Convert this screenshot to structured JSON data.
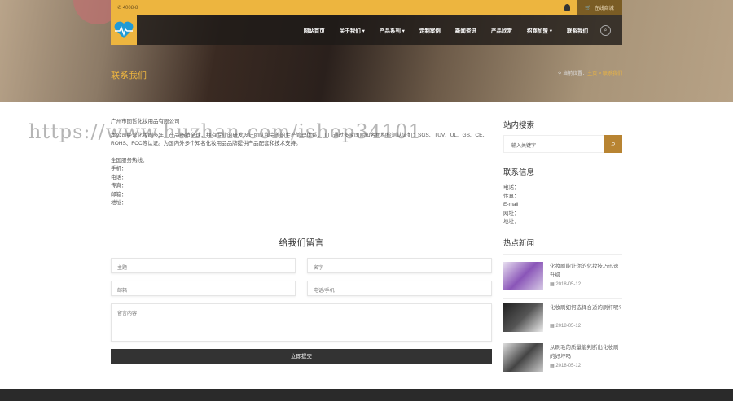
{
  "topbar": {
    "phone": "4008-8",
    "shop_label": "在线商城"
  },
  "nav": {
    "items": [
      "网站首页",
      "关于我们 ▾",
      "产品系列 ▾",
      "定制案例",
      "新闻资讯",
      "产品欣赏",
      "招商加盟 ▾",
      "联系我们"
    ]
  },
  "banner": {
    "title": "联系我们",
    "crumb_prefix": "当前位置：",
    "crumb_home": "主页",
    "crumb_sep": " > ",
    "crumb_current": "联系我们"
  },
  "main": {
    "company": "广州市图哲化妆用品有限公司",
    "para": "本公司经营化妆刷多年，产品畅销全球，拥有专业的研发设计团队和完善的生产管理体系，工厂通过多家国际知名机构检测认证如：SGS、TUV、UL、GS、CE、ROHS、FCC等认证。为国内外多个知名化妆用品品牌提供产品配套和技术支持。",
    "contact_heading": "全国服务热线：",
    "fields": [
      "手机：",
      "电话：",
      "传真：",
      "邮箱：",
      "地址："
    ]
  },
  "watermark": "https://www.huzhan.com/ishop34101",
  "form": {
    "title": "给我们留言",
    "subject": "主题",
    "name": "名字",
    "email": "邮箱",
    "phone": "电话/手机",
    "message": "留言内容",
    "submit": "立即提交"
  },
  "sidebar": {
    "search_title": "站内搜索",
    "search_placeholder": "输入关键字",
    "contact_title": "联系信息",
    "contact": [
      "电话：",
      "传真：",
      "E-mail",
      "网址：",
      "地址："
    ],
    "news_title": "热点新闻",
    "news": [
      {
        "title": "化妆刷能让你的化妆技巧迅速升级",
        "date": "2018-05-12"
      },
      {
        "title": "化妆刷如何选择合适的刷杆呢?",
        "date": "2018-05-12"
      },
      {
        "title": "从刷毛的质量能判断出化妆刷的好坏吗",
        "date": "2018-05-12"
      }
    ]
  }
}
